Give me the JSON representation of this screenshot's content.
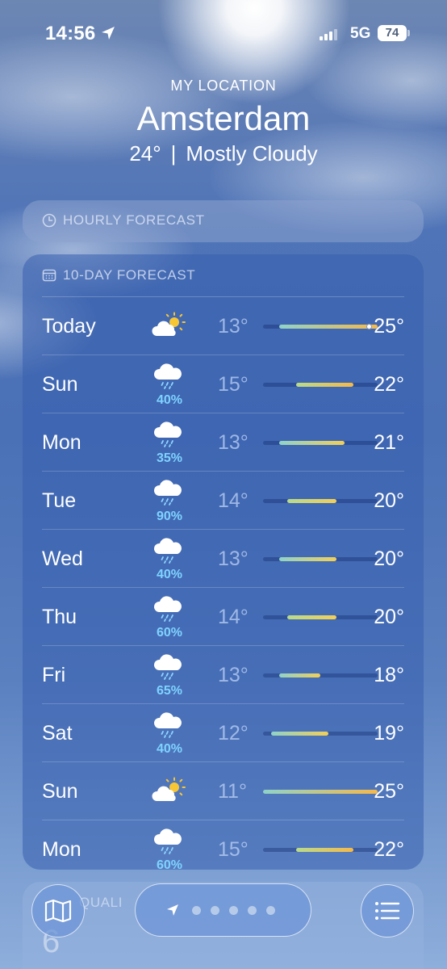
{
  "status_bar": {
    "time": "14:56",
    "network": "5G",
    "battery": "74"
  },
  "header": {
    "location_label": "MY LOCATION",
    "city": "Amsterdam",
    "temperature": "24°",
    "separator": "|",
    "condition": "Mostly Cloudy"
  },
  "hourly": {
    "title": "HOURLY FORECAST"
  },
  "ten_day": {
    "title": "10-DAY FORECAST",
    "range_min": 11,
    "range_max": 25,
    "days": [
      {
        "day": "Today",
        "icon": "sun-behind-cloud-icon",
        "precip": "",
        "low": "13°",
        "high": "25°",
        "low_val": 13,
        "high_val": 25,
        "current": 24
      },
      {
        "day": "Sun",
        "icon": "rain-cloud-icon",
        "precip": "40%",
        "low": "15°",
        "high": "22°",
        "low_val": 15,
        "high_val": 22
      },
      {
        "day": "Mon",
        "icon": "rain-cloud-icon",
        "precip": "35%",
        "low": "13°",
        "high": "21°",
        "low_val": 13,
        "high_val": 21
      },
      {
        "day": "Tue",
        "icon": "rain-cloud-icon",
        "precip": "90%",
        "low": "14°",
        "high": "20°",
        "low_val": 14,
        "high_val": 20
      },
      {
        "day": "Wed",
        "icon": "rain-cloud-icon",
        "precip": "40%",
        "low": "13°",
        "high": "20°",
        "low_val": 13,
        "high_val": 20
      },
      {
        "day": "Thu",
        "icon": "rain-cloud-icon",
        "precip": "60%",
        "low": "14°",
        "high": "20°",
        "low_val": 14,
        "high_val": 20
      },
      {
        "day": "Fri",
        "icon": "rain-cloud-icon",
        "precip": "65%",
        "low": "13°",
        "high": "18°",
        "low_val": 13,
        "high_val": 18
      },
      {
        "day": "Sat",
        "icon": "rain-cloud-icon",
        "precip": "40%",
        "low": "12°",
        "high": "19°",
        "low_val": 12,
        "high_val": 19
      },
      {
        "day": "Sun",
        "icon": "sun-behind-cloud-icon",
        "precip": "",
        "low": "11°",
        "high": "25°",
        "low_val": 11,
        "high_val": 25
      },
      {
        "day": "Mon",
        "icon": "rain-cloud-icon",
        "precip": "60%",
        "low": "15°",
        "high": "22°",
        "low_val": 15,
        "high_val": 22
      }
    ]
  },
  "air_quality": {
    "title": "QUALI",
    "value": "6"
  },
  "toolbar": {
    "page_count": 5,
    "map_icon": "map-icon",
    "list_icon": "list-icon"
  },
  "colors": {
    "precip": "#7fd3ff",
    "bar_cool": "#8fd3c8",
    "bar_mild": "#b8db8c",
    "bar_warm": "#f2cf57",
    "bar_hot": "#f5b94a"
  }
}
